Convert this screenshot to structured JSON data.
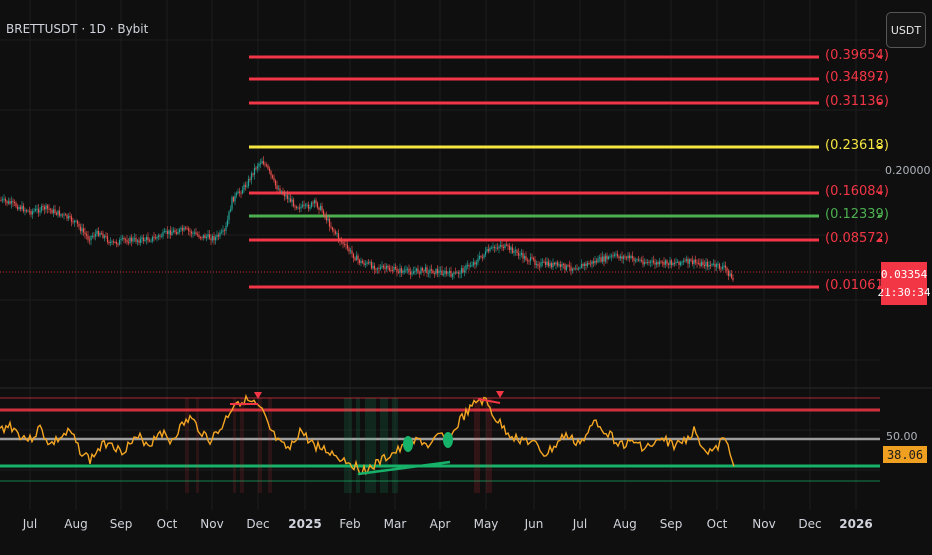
{
  "header": {
    "symbol": "BRETTUSDT · 1D · Bybit"
  },
  "currency_button": {
    "label": "USDT"
  },
  "price_axis": {
    "scale_label": "0.20000"
  },
  "last_price": {
    "value": "0.03354",
    "countdown": "21:30:34"
  },
  "rsi_panel": {
    "midline_label": "50.00",
    "current_value": "38.06"
  },
  "levels": [
    {
      "label": "(0.39654)",
      "color": "#f23645"
    },
    {
      "label": "(0.34897)",
      "color": "#f23645"
    },
    {
      "label": "(0.31136)",
      "color": "#f23645"
    },
    {
      "label": "(0.23618)",
      "color": "#f5e642"
    },
    {
      "label": "(0.16084)",
      "color": "#f23645"
    },
    {
      "label": "(0.12339)",
      "color": "#4caf50"
    },
    {
      "label": "(0.08572)",
      "color": "#f23645"
    },
    {
      "label": "(0.01061)",
      "color": "#f23645"
    }
  ],
  "time_axis": [
    {
      "label": "Jul",
      "bold": false
    },
    {
      "label": "Aug",
      "bold": false
    },
    {
      "label": "Sep",
      "bold": false
    },
    {
      "label": "Oct",
      "bold": false
    },
    {
      "label": "Nov",
      "bold": false
    },
    {
      "label": "Dec",
      "bold": false
    },
    {
      "label": "2025",
      "bold": true
    },
    {
      "label": "Feb",
      "bold": false
    },
    {
      "label": "Mar",
      "bold": false
    },
    {
      "label": "Apr",
      "bold": false
    },
    {
      "label": "May",
      "bold": false
    },
    {
      "label": "Jun",
      "bold": false
    },
    {
      "label": "Jul",
      "bold": false
    },
    {
      "label": "Aug",
      "bold": false
    },
    {
      "label": "Sep",
      "bold": false
    },
    {
      "label": "Oct",
      "bold": false
    },
    {
      "label": "Nov",
      "bold": false
    },
    {
      "label": "Dec",
      "bold": false
    },
    {
      "label": "2026",
      "bold": true
    }
  ],
  "colors": {
    "background": "#0f0f0f",
    "grid": "#1c1c1c",
    "candle_up": "#26a69a",
    "candle_down": "#ef5350",
    "rsi_line": "#f5a623",
    "rsi_overbought": "#f23645",
    "rsi_oversold": "#17b26a",
    "rsi_mid": "#9e9e9e"
  }
}
